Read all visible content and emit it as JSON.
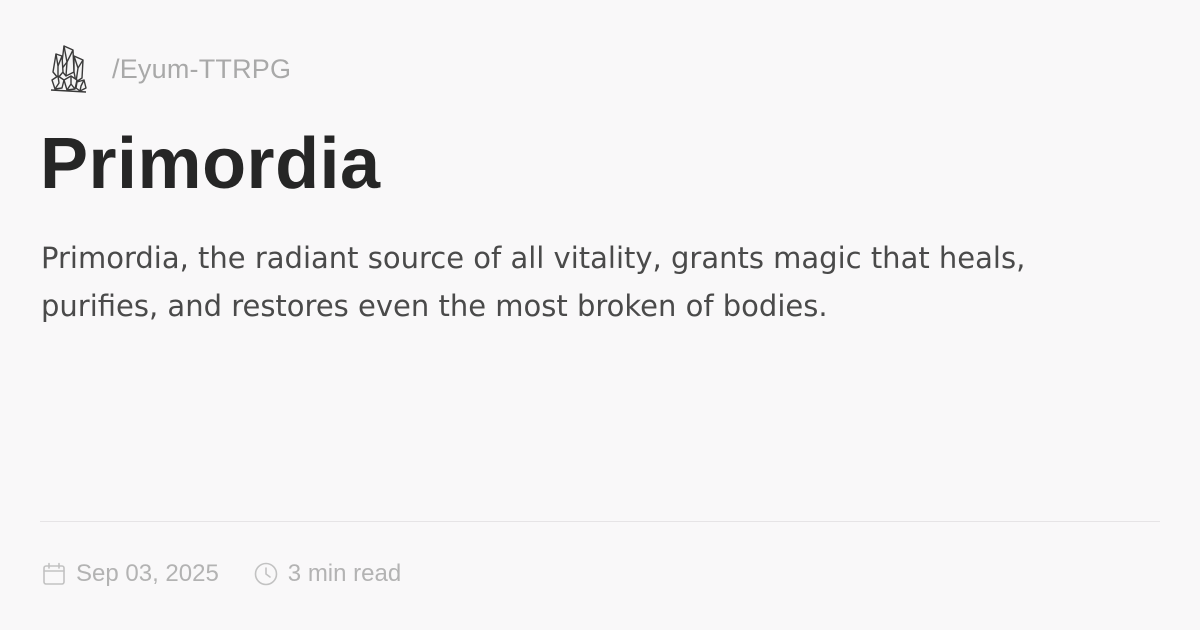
{
  "header": {
    "logo_icon": "crystal-cluster-icon",
    "site_path": "/Eyum-TTRPG"
  },
  "article": {
    "title": "Primordia",
    "description": "Primordia, the radiant source of all vitality, grants magic that heals, purifies, and restores even the most broken of bodies."
  },
  "meta": {
    "date_icon": "calendar-icon",
    "date": "Sep 03, 2025",
    "read_time_icon": "clock-icon",
    "read_time": "3 min read"
  },
  "colors": {
    "background": "#f9f8f9",
    "title": "#262626",
    "body_text": "#4a4a4a",
    "muted": "#b3b3b3",
    "divider": "#e6e4e6"
  }
}
